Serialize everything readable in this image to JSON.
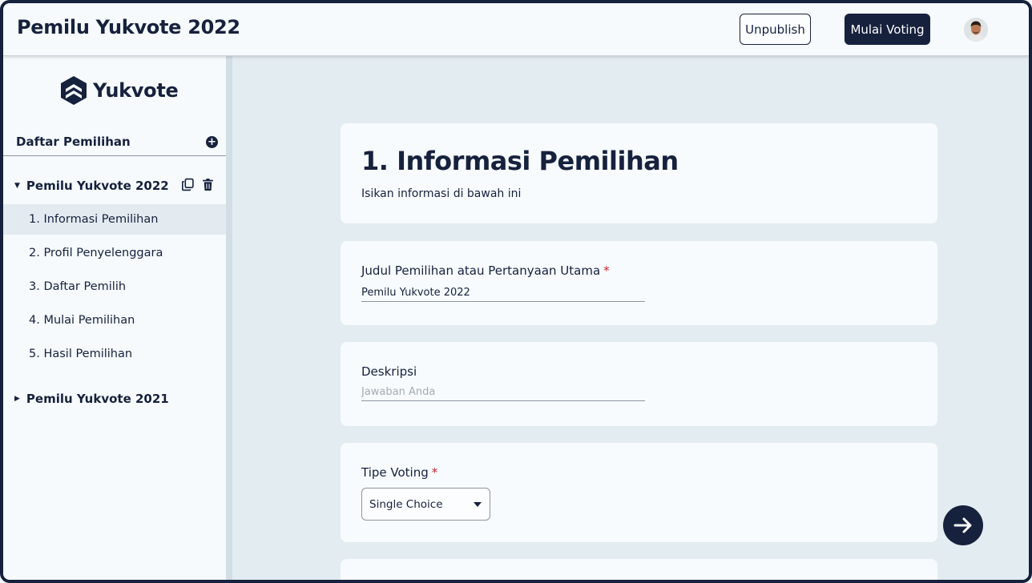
{
  "header": {
    "title": "Pemilu Yukvote 2022",
    "unpublish_label": "Unpublish",
    "start_voting_label": "Mulai Voting"
  },
  "sidebar": {
    "logo_text": "Yukvote",
    "section_label": "Daftar Pemilihan",
    "elections": [
      {
        "label": "Pemilu Yukvote 2022",
        "expanded": true,
        "items": [
          {
            "label": "1. Informasi Pemilihan",
            "active": true
          },
          {
            "label": "2. Profil Penyelenggara",
            "active": false
          },
          {
            "label": "3. Daftar Pemilih",
            "active": false
          },
          {
            "label": "4. Mulai Pemilihan",
            "active": false
          },
          {
            "label": "5. Hasil Pemilihan",
            "active": false
          }
        ]
      },
      {
        "label": "Pemilu Yukvote 2021",
        "expanded": false,
        "items": []
      }
    ]
  },
  "main": {
    "heading": "1. Informasi Pemilihan",
    "subheading": "Isikan informasi di bawah ini",
    "title_field": {
      "label": "Judul Pemilihan atau Pertanyaan Utama",
      "required_mark": "*",
      "value": "Pemilu Yukvote 2022"
    },
    "description_field": {
      "label": "Deskripsi",
      "placeholder": "Jawaban Anda",
      "value": ""
    },
    "voting_type_field": {
      "label": "Tipe Voting",
      "required_mark": "*",
      "selected": "Single Choice"
    }
  },
  "colors": {
    "primary": "#16213d",
    "required": "#c0282d",
    "main_bg": "#e3ecf1",
    "card_bg": "#f7fbfe"
  },
  "icons": {
    "add": "plus-circle-icon",
    "copy": "copy-icon",
    "delete": "trash-icon",
    "next": "arrow-right-icon"
  }
}
